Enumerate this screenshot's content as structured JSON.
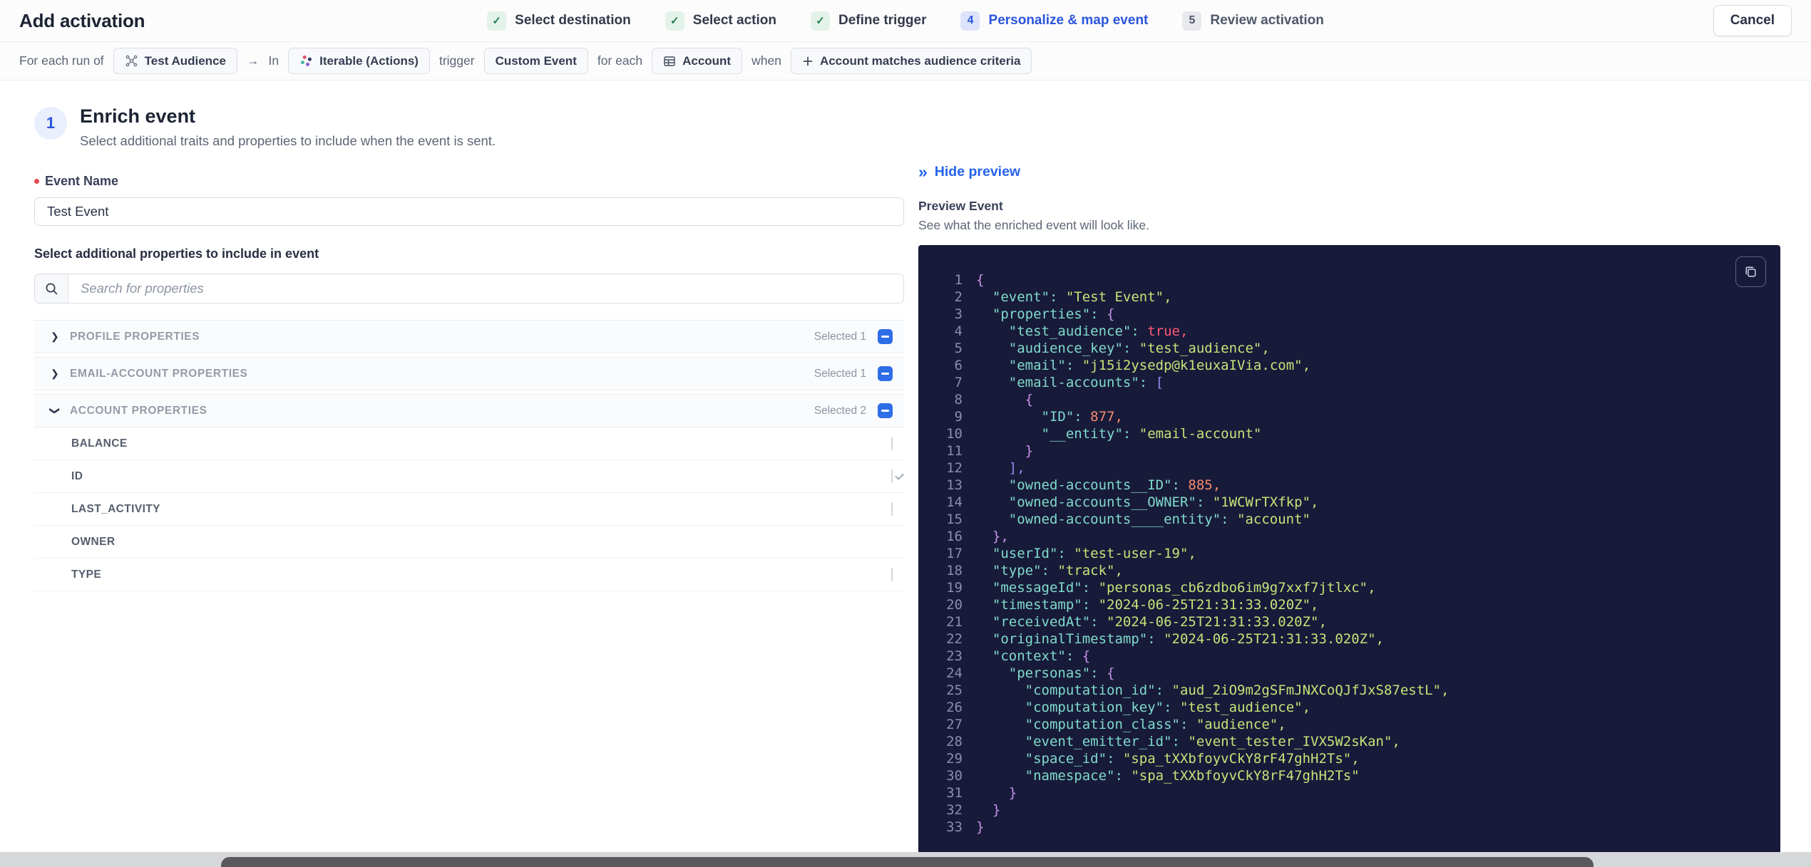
{
  "header": {
    "title": "Add activation",
    "cancel_label": "Cancel",
    "steps": [
      {
        "label": "Select destination",
        "state": "done"
      },
      {
        "label": "Select action",
        "state": "done"
      },
      {
        "label": "Define trigger",
        "state": "done"
      },
      {
        "label": "Personalize & map event",
        "state": "active",
        "number": "4"
      },
      {
        "label": "Review activation",
        "state": "upcoming",
        "number": "5"
      }
    ]
  },
  "summary_bar": {
    "segments": [
      {
        "type": "text",
        "text": "For each run of"
      },
      {
        "type": "chip",
        "icon": "audience-icon",
        "text": "Test Audience"
      },
      {
        "type": "text",
        "text": "→"
      },
      {
        "type": "text",
        "text": "In"
      },
      {
        "type": "chip",
        "icon": "iterable-icon",
        "text": "Iterable (Actions)"
      },
      {
        "type": "text",
        "text": "trigger"
      },
      {
        "type": "chip",
        "text": "Custom Event"
      },
      {
        "type": "text",
        "text": "for each"
      },
      {
        "type": "chip",
        "icon": "table-icon",
        "text": "Account"
      },
      {
        "type": "text",
        "text": "when"
      },
      {
        "type": "chip",
        "icon": "plus-icon",
        "text": "Account matches audience criteria"
      }
    ]
  },
  "enrich": {
    "step_number": "1",
    "title": "Enrich event",
    "subtitle": "Select additional traits and properties to include when the event is sent.",
    "event_name_label": "Event Name",
    "event_name_value": "Test Event",
    "properties_label": "Select additional properties to include in event",
    "search_placeholder": "Search for properties",
    "groups": [
      {
        "label": "PROFILE PROPERTIES",
        "selected_text": "Selected 1",
        "expanded": false,
        "checkbox": "indeterminate"
      },
      {
        "label": "EMAIL-ACCOUNT PROPERTIES",
        "selected_text": "Selected 1",
        "expanded": false,
        "checkbox": "indeterminate"
      },
      {
        "label": "ACCOUNT PROPERTIES",
        "selected_text": "Selected 2",
        "expanded": true,
        "checkbox": "indeterminate"
      }
    ],
    "account_properties": [
      {
        "label": "BALANCE",
        "checkbox": "unchecked"
      },
      {
        "label": "ID",
        "checkbox": "checked-disabled"
      },
      {
        "label": "LAST_ACTIVITY",
        "checkbox": "unchecked"
      },
      {
        "label": "OWNER",
        "checkbox": "checked"
      },
      {
        "label": "TYPE",
        "checkbox": "unchecked"
      }
    ]
  },
  "preview": {
    "hide_label": "Hide preview",
    "title": "Preview Event",
    "subtitle": "See what the enriched event will look like.",
    "code_lines": [
      {
        "n": "1",
        "tokens": [
          [
            "brace",
            "{"
          ]
        ]
      },
      {
        "n": "2",
        "tokens": [
          [
            "key",
            "  \"event\": "
          ],
          [
            "str",
            "\"Test Event\","
          ]
        ]
      },
      {
        "n": "3",
        "tokens": [
          [
            "key",
            "  \"properties\": "
          ],
          [
            "brace",
            "{"
          ]
        ]
      },
      {
        "n": "4",
        "tokens": [
          [
            "key",
            "    \"test_audience\": "
          ],
          [
            "bool",
            "true,"
          ]
        ]
      },
      {
        "n": "5",
        "tokens": [
          [
            "key",
            "    \"audience_key\": "
          ],
          [
            "str",
            "\"test_audience\","
          ]
        ]
      },
      {
        "n": "6",
        "tokens": [
          [
            "key",
            "    \"email\": "
          ],
          [
            "str",
            "\"j15i2ysedp@k1euxaIVia.com\","
          ]
        ]
      },
      {
        "n": "7",
        "tokens": [
          [
            "key",
            "    \"email-accounts\": "
          ],
          [
            "bracket",
            "["
          ]
        ]
      },
      {
        "n": "8",
        "tokens": [
          [
            "brace",
            "      {"
          ]
        ]
      },
      {
        "n": "9",
        "tokens": [
          [
            "key",
            "        \"ID\": "
          ],
          [
            "num",
            "877,"
          ]
        ]
      },
      {
        "n": "10",
        "tokens": [
          [
            "key",
            "        \"__entity\": "
          ],
          [
            "str",
            "\"email-account\""
          ]
        ]
      },
      {
        "n": "11",
        "tokens": [
          [
            "brace",
            "      }"
          ]
        ]
      },
      {
        "n": "12",
        "tokens": [
          [
            "bracket",
            "    ],"
          ]
        ]
      },
      {
        "n": "13",
        "tokens": [
          [
            "key",
            "    \"owned-accounts__ID\": "
          ],
          [
            "num",
            "885,"
          ]
        ]
      },
      {
        "n": "14",
        "tokens": [
          [
            "key",
            "    \"owned-accounts__OWNER\": "
          ],
          [
            "str",
            "\"1WCWrTXfkp\","
          ]
        ]
      },
      {
        "n": "15",
        "tokens": [
          [
            "key",
            "    \"owned-accounts____entity\": "
          ],
          [
            "str",
            "\"account\""
          ]
        ]
      },
      {
        "n": "16",
        "tokens": [
          [
            "brace",
            "  },"
          ]
        ]
      },
      {
        "n": "17",
        "tokens": [
          [
            "key",
            "  \"userId\": "
          ],
          [
            "str",
            "\"test-user-19\","
          ]
        ]
      },
      {
        "n": "18",
        "tokens": [
          [
            "key",
            "  \"type\": "
          ],
          [
            "str",
            "\"track\","
          ]
        ]
      },
      {
        "n": "19",
        "tokens": [
          [
            "key",
            "  \"messageId\": "
          ],
          [
            "str",
            "\"personas_cb6zdbo6im9g7xxf7jtlxc\","
          ]
        ]
      },
      {
        "n": "20",
        "tokens": [
          [
            "key",
            "  \"timestamp\": "
          ],
          [
            "str",
            "\"2024-06-25T21:31:33.020Z\","
          ]
        ]
      },
      {
        "n": "21",
        "tokens": [
          [
            "key",
            "  \"receivedAt\": "
          ],
          [
            "str",
            "\"2024-06-25T21:31:33.020Z\","
          ]
        ]
      },
      {
        "n": "22",
        "tokens": [
          [
            "key",
            "  \"originalTimestamp\": "
          ],
          [
            "str",
            "\"2024-06-25T21:31:33.020Z\","
          ]
        ]
      },
      {
        "n": "23",
        "tokens": [
          [
            "key",
            "  \"context\": "
          ],
          [
            "brace",
            "{"
          ]
        ]
      },
      {
        "n": "24",
        "tokens": [
          [
            "key",
            "    \"personas\": "
          ],
          [
            "brace",
            "{"
          ]
        ]
      },
      {
        "n": "25",
        "tokens": [
          [
            "key",
            "      \"computation_id\": "
          ],
          [
            "str",
            "\"aud_2iO9m2gSFmJNXCoQJfJxS87estL\","
          ]
        ]
      },
      {
        "n": "26",
        "tokens": [
          [
            "key",
            "      \"computation_key\": "
          ],
          [
            "str",
            "\"test_audience\","
          ]
        ]
      },
      {
        "n": "27",
        "tokens": [
          [
            "key",
            "      \"computation_class\": "
          ],
          [
            "str",
            "\"audience\","
          ]
        ]
      },
      {
        "n": "28",
        "tokens": [
          [
            "key",
            "      \"event_emitter_id\": "
          ],
          [
            "str",
            "\"event_tester_IVX5W2sKan\","
          ]
        ]
      },
      {
        "n": "29",
        "tokens": [
          [
            "key",
            "      \"space_id\": "
          ],
          [
            "str",
            "\"spa_tXXbfoyvCkY8rF47ghH2Ts\","
          ]
        ]
      },
      {
        "n": "30",
        "tokens": [
          [
            "key",
            "      \"namespace\": "
          ],
          [
            "str",
            "\"spa_tXXbfoyvCkY8rF47ghH2Ts\""
          ]
        ]
      },
      {
        "n": "31",
        "tokens": [
          [
            "brace",
            "    }"
          ]
        ]
      },
      {
        "n": "32",
        "tokens": [
          [
            "brace",
            "  }"
          ]
        ]
      },
      {
        "n": "33",
        "tokens": [
          [
            "brace",
            "}"
          ]
        ]
      }
    ]
  },
  "icons": {
    "check": "✓",
    "collapse": "»",
    "chevron": "❯"
  },
  "colors": {
    "accent_blue": "#2b55dd",
    "link_blue": "#2563eb",
    "checkbox_blue": "#2e6de8",
    "success_green": "#1e7f4f",
    "code_bg": "#181a3a",
    "code_key": "#7fdbca",
    "code_string": "#c5e478",
    "code_number": "#f78c6c",
    "code_bool": "#ff5874",
    "code_brace": "#c792ea",
    "code_bracket": "#8f8df2"
  }
}
